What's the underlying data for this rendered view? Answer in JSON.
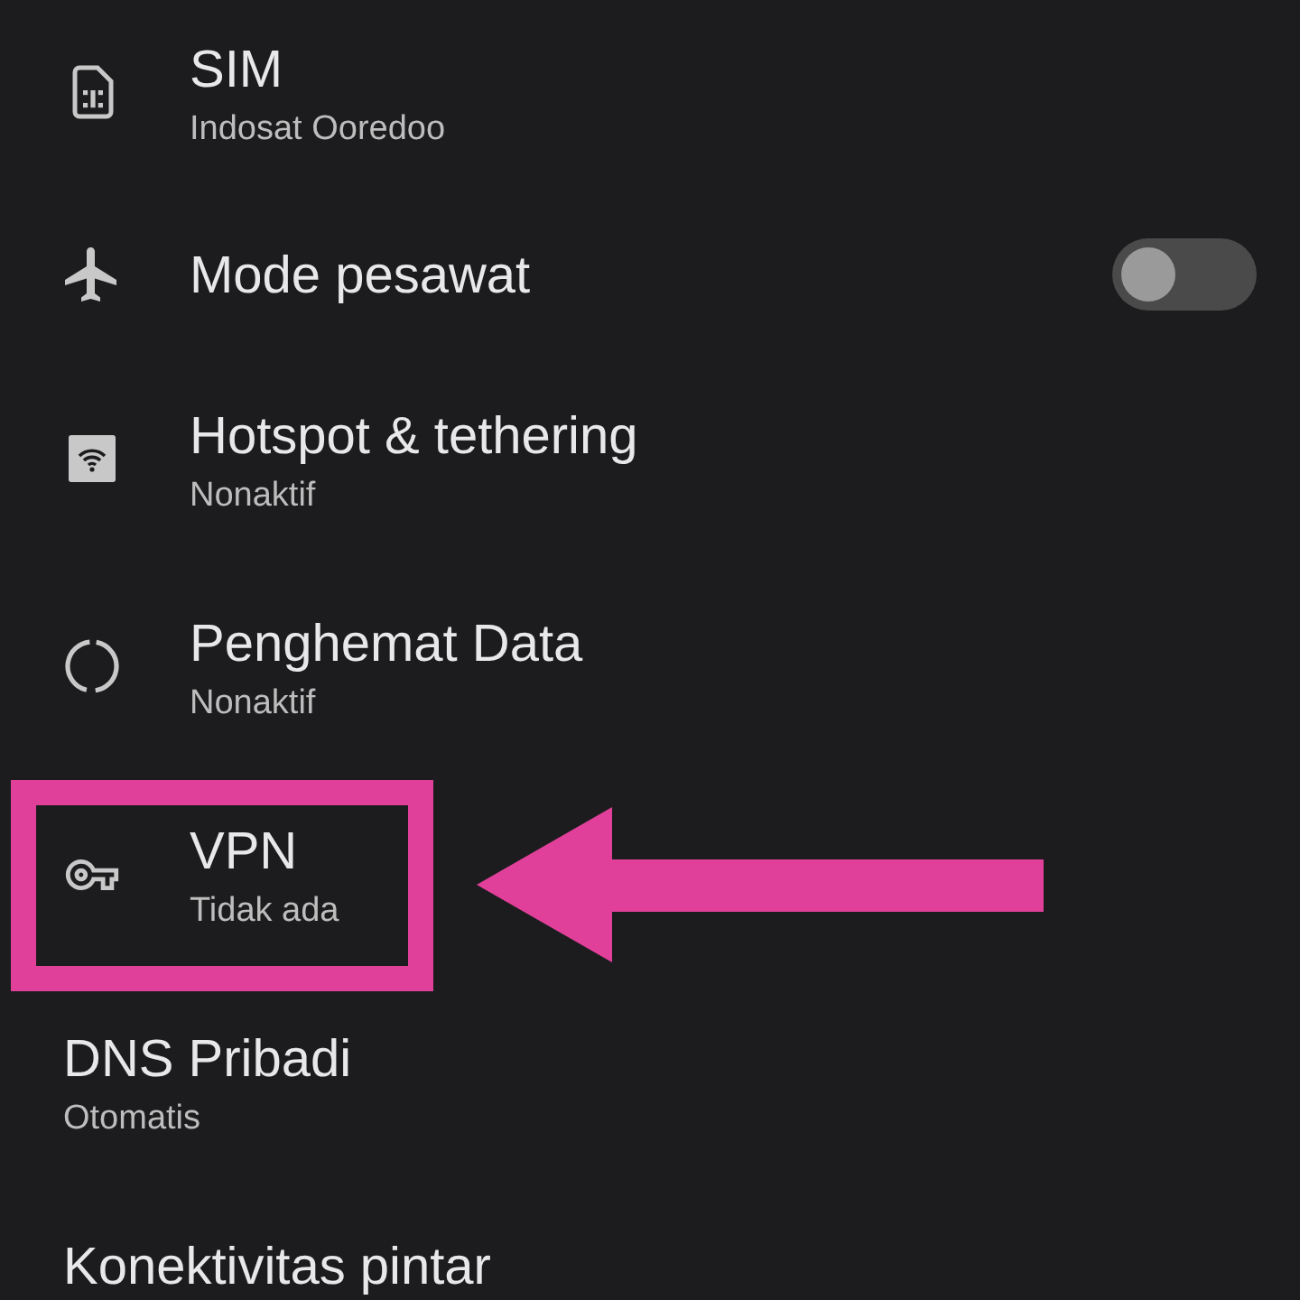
{
  "items": [
    {
      "kind": "sim",
      "title": "SIM",
      "subtitle": "Indosat Ooredoo",
      "highlighted": false
    },
    {
      "kind": "airplane",
      "title": "Mode pesawat",
      "on": false,
      "highlighted": false
    },
    {
      "kind": "hotspot",
      "title": "Hotspot & tethering",
      "subtitle": "Nonaktif",
      "highlighted": false
    },
    {
      "kind": "data_saver",
      "title": "Penghemat Data",
      "subtitle": "Nonaktif",
      "highlighted": false
    },
    {
      "kind": "vpn",
      "title": "VPN",
      "subtitle": "Tidak ada",
      "highlighted": true
    },
    {
      "kind": "plain",
      "title": "DNS Pribadi",
      "subtitle": "Otomatis",
      "highlighted": false
    },
    {
      "kind": "plain",
      "title": "Konektivitas pintar",
      "highlighted": false
    }
  ]
}
